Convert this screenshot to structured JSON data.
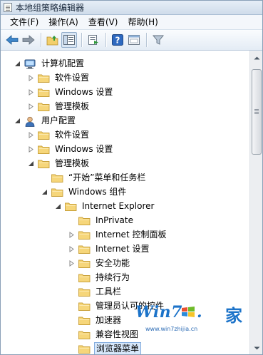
{
  "window": {
    "title": "本地组策略编辑器"
  },
  "menu": [
    "文件(F)",
    "操作(A)",
    "查看(V)",
    "帮助(H)"
  ],
  "toolbar": [
    {
      "name": "back-arrow-icon"
    },
    {
      "name": "forward-arrow-icon"
    },
    {
      "name": "up-folder-icon"
    },
    {
      "name": "show-hide-tree-icon",
      "pressed": true
    },
    {
      "name": "export-list-icon"
    },
    {
      "name": "help-icon"
    },
    {
      "name": "properties-icon"
    },
    {
      "name": "filter-icon"
    }
  ],
  "tree": [
    {
      "label": "计算机配置",
      "level": 0,
      "toggle": "expanded",
      "icon": "computer-icon"
    },
    {
      "label": "软件设置",
      "level": 1,
      "toggle": "collapsed",
      "icon": "folder-icon"
    },
    {
      "label": "Windows 设置",
      "level": 1,
      "toggle": "collapsed",
      "icon": "folder-icon"
    },
    {
      "label": "管理模板",
      "level": 1,
      "toggle": "collapsed",
      "icon": "folder-icon"
    },
    {
      "label": "用户配置",
      "level": 0,
      "toggle": "expanded",
      "icon": "user-icon"
    },
    {
      "label": "软件设置",
      "level": 1,
      "toggle": "collapsed",
      "icon": "folder-icon"
    },
    {
      "label": "Windows 设置",
      "level": 1,
      "toggle": "collapsed",
      "icon": "folder-icon"
    },
    {
      "label": "管理模板",
      "level": 1,
      "toggle": "expanded",
      "icon": "folder-icon"
    },
    {
      "label": "“开始”菜单和任务栏",
      "level": 2,
      "toggle": "none",
      "icon": "folder-icon"
    },
    {
      "label": "Windows 组件",
      "level": 2,
      "toggle": "expanded",
      "icon": "folder-icon"
    },
    {
      "label": "Internet Explorer",
      "level": 3,
      "toggle": "expanded",
      "icon": "folder-icon"
    },
    {
      "label": "InPrivate",
      "level": 4,
      "toggle": "none",
      "icon": "folder-icon"
    },
    {
      "label": "Internet 控制面板",
      "level": 4,
      "toggle": "collapsed",
      "icon": "folder-icon"
    },
    {
      "label": "Internet 设置",
      "level": 4,
      "toggle": "collapsed",
      "icon": "folder-icon"
    },
    {
      "label": "安全功能",
      "level": 4,
      "toggle": "collapsed",
      "icon": "folder-icon"
    },
    {
      "label": "持续行为",
      "level": 4,
      "toggle": "none",
      "icon": "folder-icon"
    },
    {
      "label": "工具栏",
      "level": 4,
      "toggle": "none",
      "icon": "folder-icon"
    },
    {
      "label": "管理员认可的控件",
      "level": 4,
      "toggle": "none",
      "icon": "folder-icon"
    },
    {
      "label": "加速器",
      "level": 4,
      "toggle": "none",
      "icon": "folder-icon"
    },
    {
      "label": "兼容性视图",
      "level": 4,
      "toggle": "none",
      "icon": "folder-icon"
    },
    {
      "label": "浏览器菜单",
      "level": 4,
      "toggle": "none",
      "icon": "folder-icon",
      "selected": true
    }
  ],
  "watermark": {
    "brand": "Win7",
    "jia": "家",
    "url": "www.win7zhijia.cn"
  },
  "colors": {
    "folder_fill": "#f6d67a",
    "folder_edge": "#c9a13a",
    "selection": "#d7e8fb"
  }
}
